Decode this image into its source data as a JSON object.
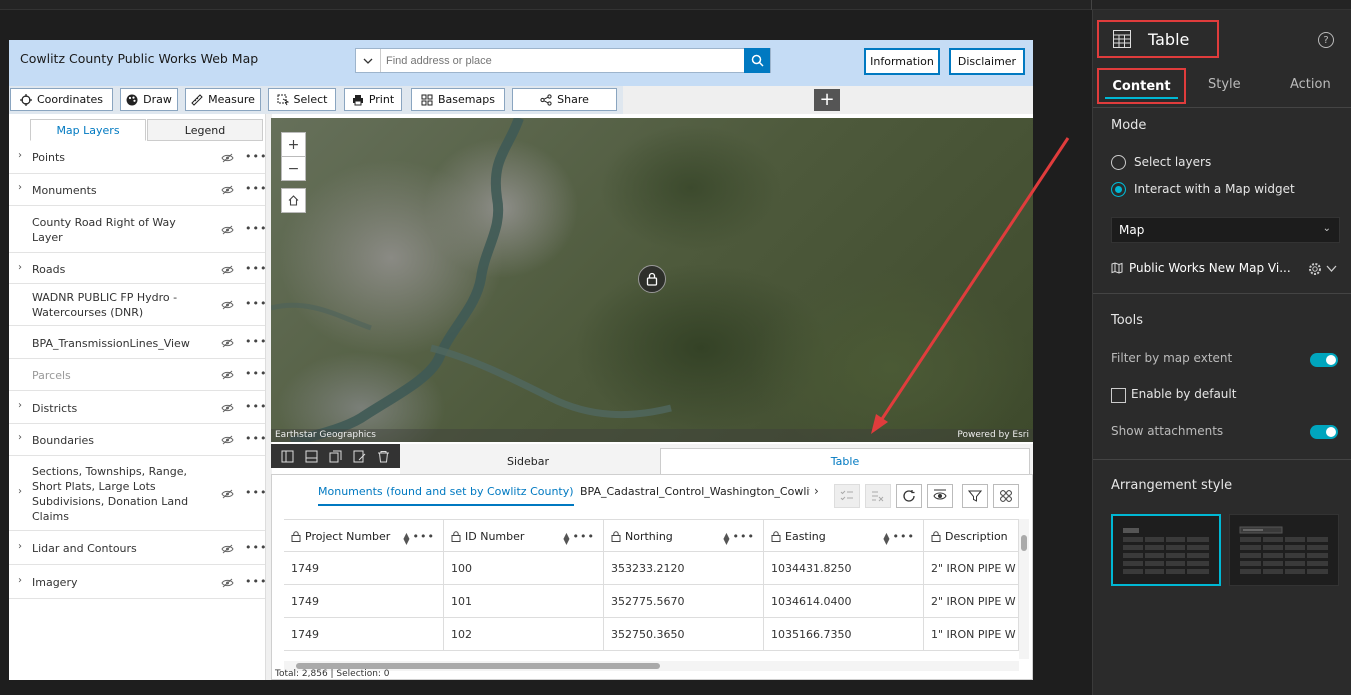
{
  "app": {
    "title": "Cowlitz County Public Works Web Map",
    "search_placeholder": "Find address or place",
    "info_button": "Information",
    "disclaimer_button": "Disclaimer"
  },
  "toolbar": {
    "coordinates": "Coordinates",
    "draw": "Draw",
    "measure": "Measure",
    "select": "Select",
    "print": "Print",
    "basemaps": "Basemaps",
    "share": "Share",
    "add": "+"
  },
  "layers": {
    "tab_map_layers": "Map Layers",
    "tab_legend": "Legend",
    "items": [
      {
        "label": "Points",
        "expandable": true,
        "dim": false
      },
      {
        "label": "Monuments",
        "expandable": true,
        "dim": false
      },
      {
        "label": "County Road Right of Way Layer",
        "expandable": false,
        "dim": false
      },
      {
        "label": "Roads",
        "expandable": true,
        "dim": false
      },
      {
        "label": "WADNR PUBLIC FP Hydro - Watercourses (DNR)",
        "expandable": false,
        "dim": false
      },
      {
        "label": "BPA_TransmissionLines_View",
        "expandable": false,
        "dim": false
      },
      {
        "label": "Parcels",
        "expandable": false,
        "dim": true
      },
      {
        "label": "Districts",
        "expandable": true,
        "dim": false
      },
      {
        "label": "Boundaries",
        "expandable": true,
        "dim": false
      },
      {
        "label": "Sections, Townships, Range, Short Plats, Large Lots Subdivisions, Donation Land Claims",
        "expandable": true,
        "dim": false
      },
      {
        "label": "Lidar and Contours",
        "expandable": true,
        "dim": false
      },
      {
        "label": "Imagery",
        "expandable": true,
        "dim": false
      }
    ]
  },
  "map": {
    "zoom_in": "+",
    "zoom_out": "−",
    "attribution_left": "Earthstar Geographics",
    "attribution_right": "Powered by Esri"
  },
  "section_tabs": {
    "sidebar": "Sidebar",
    "table": "Table"
  },
  "table": {
    "tab_active": "Monuments (found and set by Cowlitz County)",
    "tab_other": "BPA_Cadastral_Control_Washington_Cowlitz",
    "columns": [
      "Project Number",
      "ID Number",
      "Northing",
      "Easting",
      "Description"
    ],
    "rows": [
      [
        "1749",
        "100",
        "353233.2120",
        "1034431.8250",
        "2\" IRON PIPE W"
      ],
      [
        "1749",
        "101",
        "352775.5670",
        "1034614.0400",
        "2\" IRON PIPE W"
      ],
      [
        "1749",
        "102",
        "352750.3650",
        "1035166.7350",
        "1\" IRON PIPE W"
      ]
    ],
    "footer": "Total: 2,856 | Selection: 0"
  },
  "panel": {
    "title": "Table",
    "help": "?",
    "tabs": {
      "content": "Content",
      "style": "Style",
      "action": "Action"
    },
    "mode_label": "Mode",
    "mode_select_layers": "Select layers",
    "mode_interact": "Interact with a Map widget",
    "mode_selected": "interact",
    "map_select_value": "Map",
    "map_reference": "Public Works New Map Vi...",
    "tools_label": "Tools",
    "filter_by_extent": "Filter by map extent",
    "filter_by_extent_on": true,
    "enable_by_default": "Enable by default",
    "enable_by_default_checked": false,
    "show_attachments": "Show attachments",
    "show_attachments_on": true,
    "arrangement_label": "Arrangement style"
  },
  "colors": {
    "accent": "#0079c1",
    "panel_accent": "#00b8d4",
    "highlight": "#e03c3c"
  }
}
